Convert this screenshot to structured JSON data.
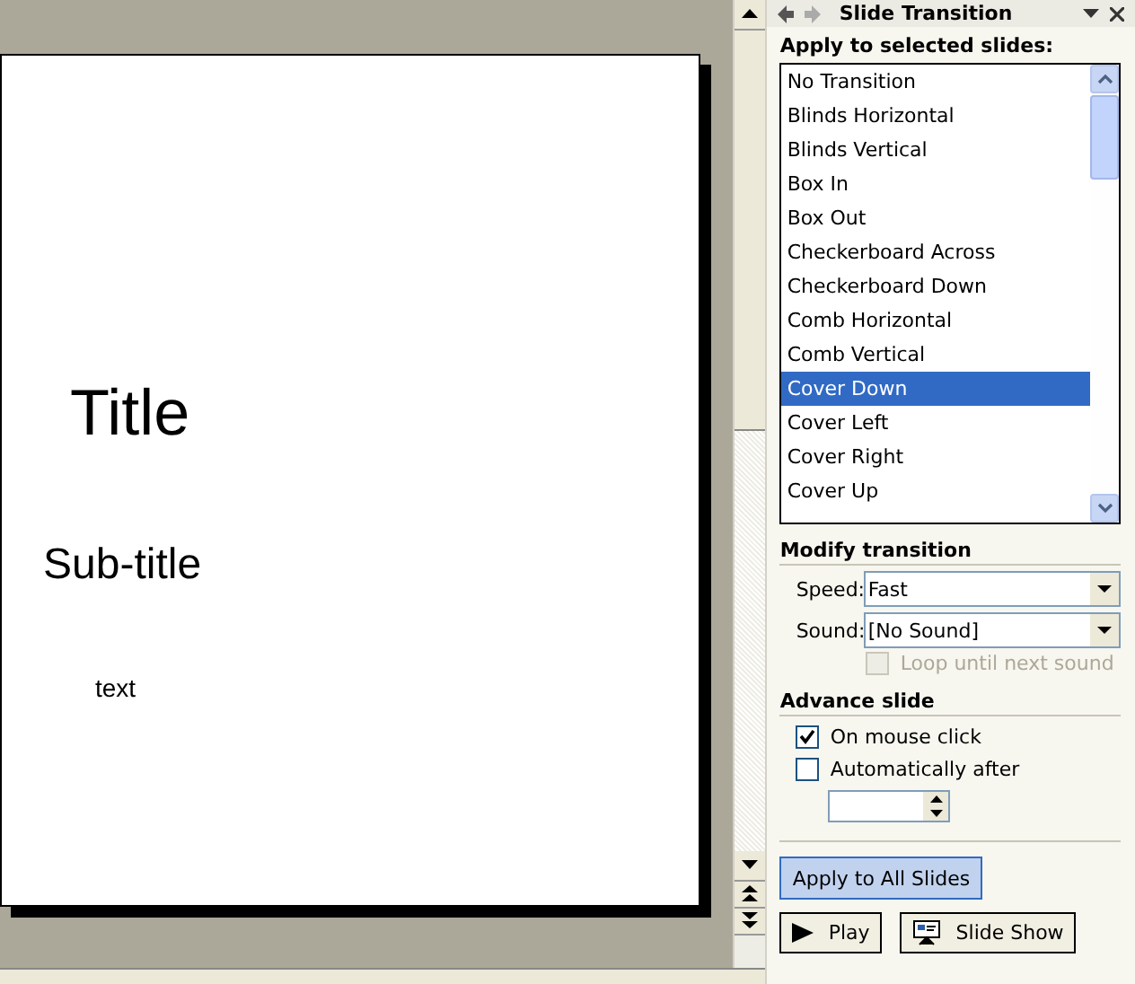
{
  "slide": {
    "title": "Title",
    "subtitle": "Sub-title",
    "body": "text"
  },
  "pane": {
    "title": "Slide Transition",
    "apply_label": "Apply to selected slides:",
    "transitions": [
      {
        "label": "No Transition",
        "selected": false
      },
      {
        "label": "Blinds Horizontal",
        "selected": false
      },
      {
        "label": "Blinds Vertical",
        "selected": false
      },
      {
        "label": "Box In",
        "selected": false
      },
      {
        "label": "Box Out",
        "selected": false
      },
      {
        "label": "Checkerboard Across",
        "selected": false
      },
      {
        "label": "Checkerboard Down",
        "selected": false
      },
      {
        "label": "Comb Horizontal",
        "selected": false
      },
      {
        "label": "Comb Vertical",
        "selected": false
      },
      {
        "label": "Cover Down",
        "selected": true
      },
      {
        "label": "Cover Left",
        "selected": false
      },
      {
        "label": "Cover Right",
        "selected": false
      },
      {
        "label": "Cover Up",
        "selected": false
      }
    ],
    "modify_heading": "Modify transition",
    "speed": {
      "label": "Speed:",
      "value": "Fast"
    },
    "sound": {
      "label": "Sound:",
      "value": "[No Sound]"
    },
    "loop": {
      "label": "Loop until next sound",
      "checked": false,
      "disabled": true
    },
    "advance_heading": "Advance slide",
    "advance_options": [
      {
        "label": "On mouse click",
        "checked": true
      },
      {
        "label": "Automatically after",
        "checked": false
      }
    ],
    "apply_all_button": "Apply to All Slides",
    "play_button": "Play",
    "slideshow_button": "Slide Show"
  }
}
